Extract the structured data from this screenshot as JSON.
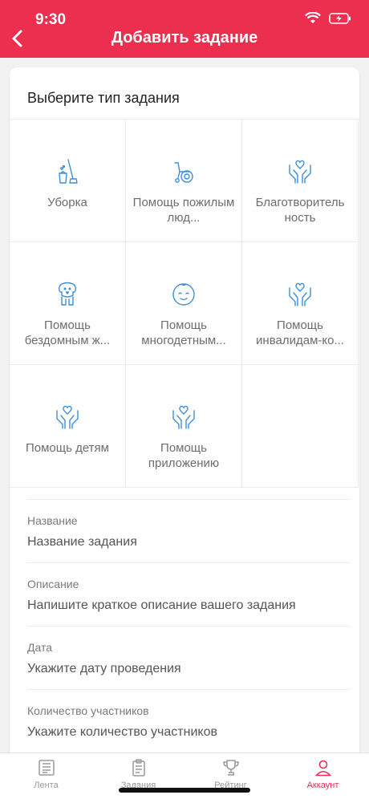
{
  "status": {
    "time": "9:30"
  },
  "header": {
    "title": "Добавить задание"
  },
  "section": {
    "title": "Выберите тип задания"
  },
  "task_types": [
    {
      "label": "Уборка",
      "icon": "broom-bucket-icon"
    },
    {
      "label": "Помощь пожилым люд...",
      "icon": "wheelchair-icon"
    },
    {
      "label": "Благотворитель ность",
      "icon": "hands-heart-icon"
    },
    {
      "label": "Помощь бездомным ж...",
      "icon": "dog-icon"
    },
    {
      "label": "Помощь многодетным...",
      "icon": "baby-face-icon"
    },
    {
      "label": "Помощь инвалидам-ко...",
      "icon": "hands-heart-icon"
    },
    {
      "label": "Помощь детям",
      "icon": "hands-heart-icon"
    },
    {
      "label": "Помощь приложению",
      "icon": "hands-heart-icon"
    }
  ],
  "form": {
    "name": {
      "label": "Название",
      "placeholder": "Название задания"
    },
    "description": {
      "label": "Описание",
      "placeholder": "Напишите краткое описание вашего задания"
    },
    "date": {
      "label": "Дата",
      "placeholder": "Укажите дату проведения"
    },
    "participants": {
      "label": "Количество участников",
      "placeholder": "Укажите количество участников"
    }
  },
  "tabs": [
    {
      "label": "Лента",
      "icon": "newspaper-icon"
    },
    {
      "label": "Задания",
      "icon": "clipboard-icon"
    },
    {
      "label": "Рейтинг",
      "icon": "trophy-icon"
    },
    {
      "label": "Аккаунт",
      "icon": "user-icon"
    }
  ],
  "colors": {
    "accent": "#ec2e4f",
    "icon_blue": "#3f8fd8"
  }
}
